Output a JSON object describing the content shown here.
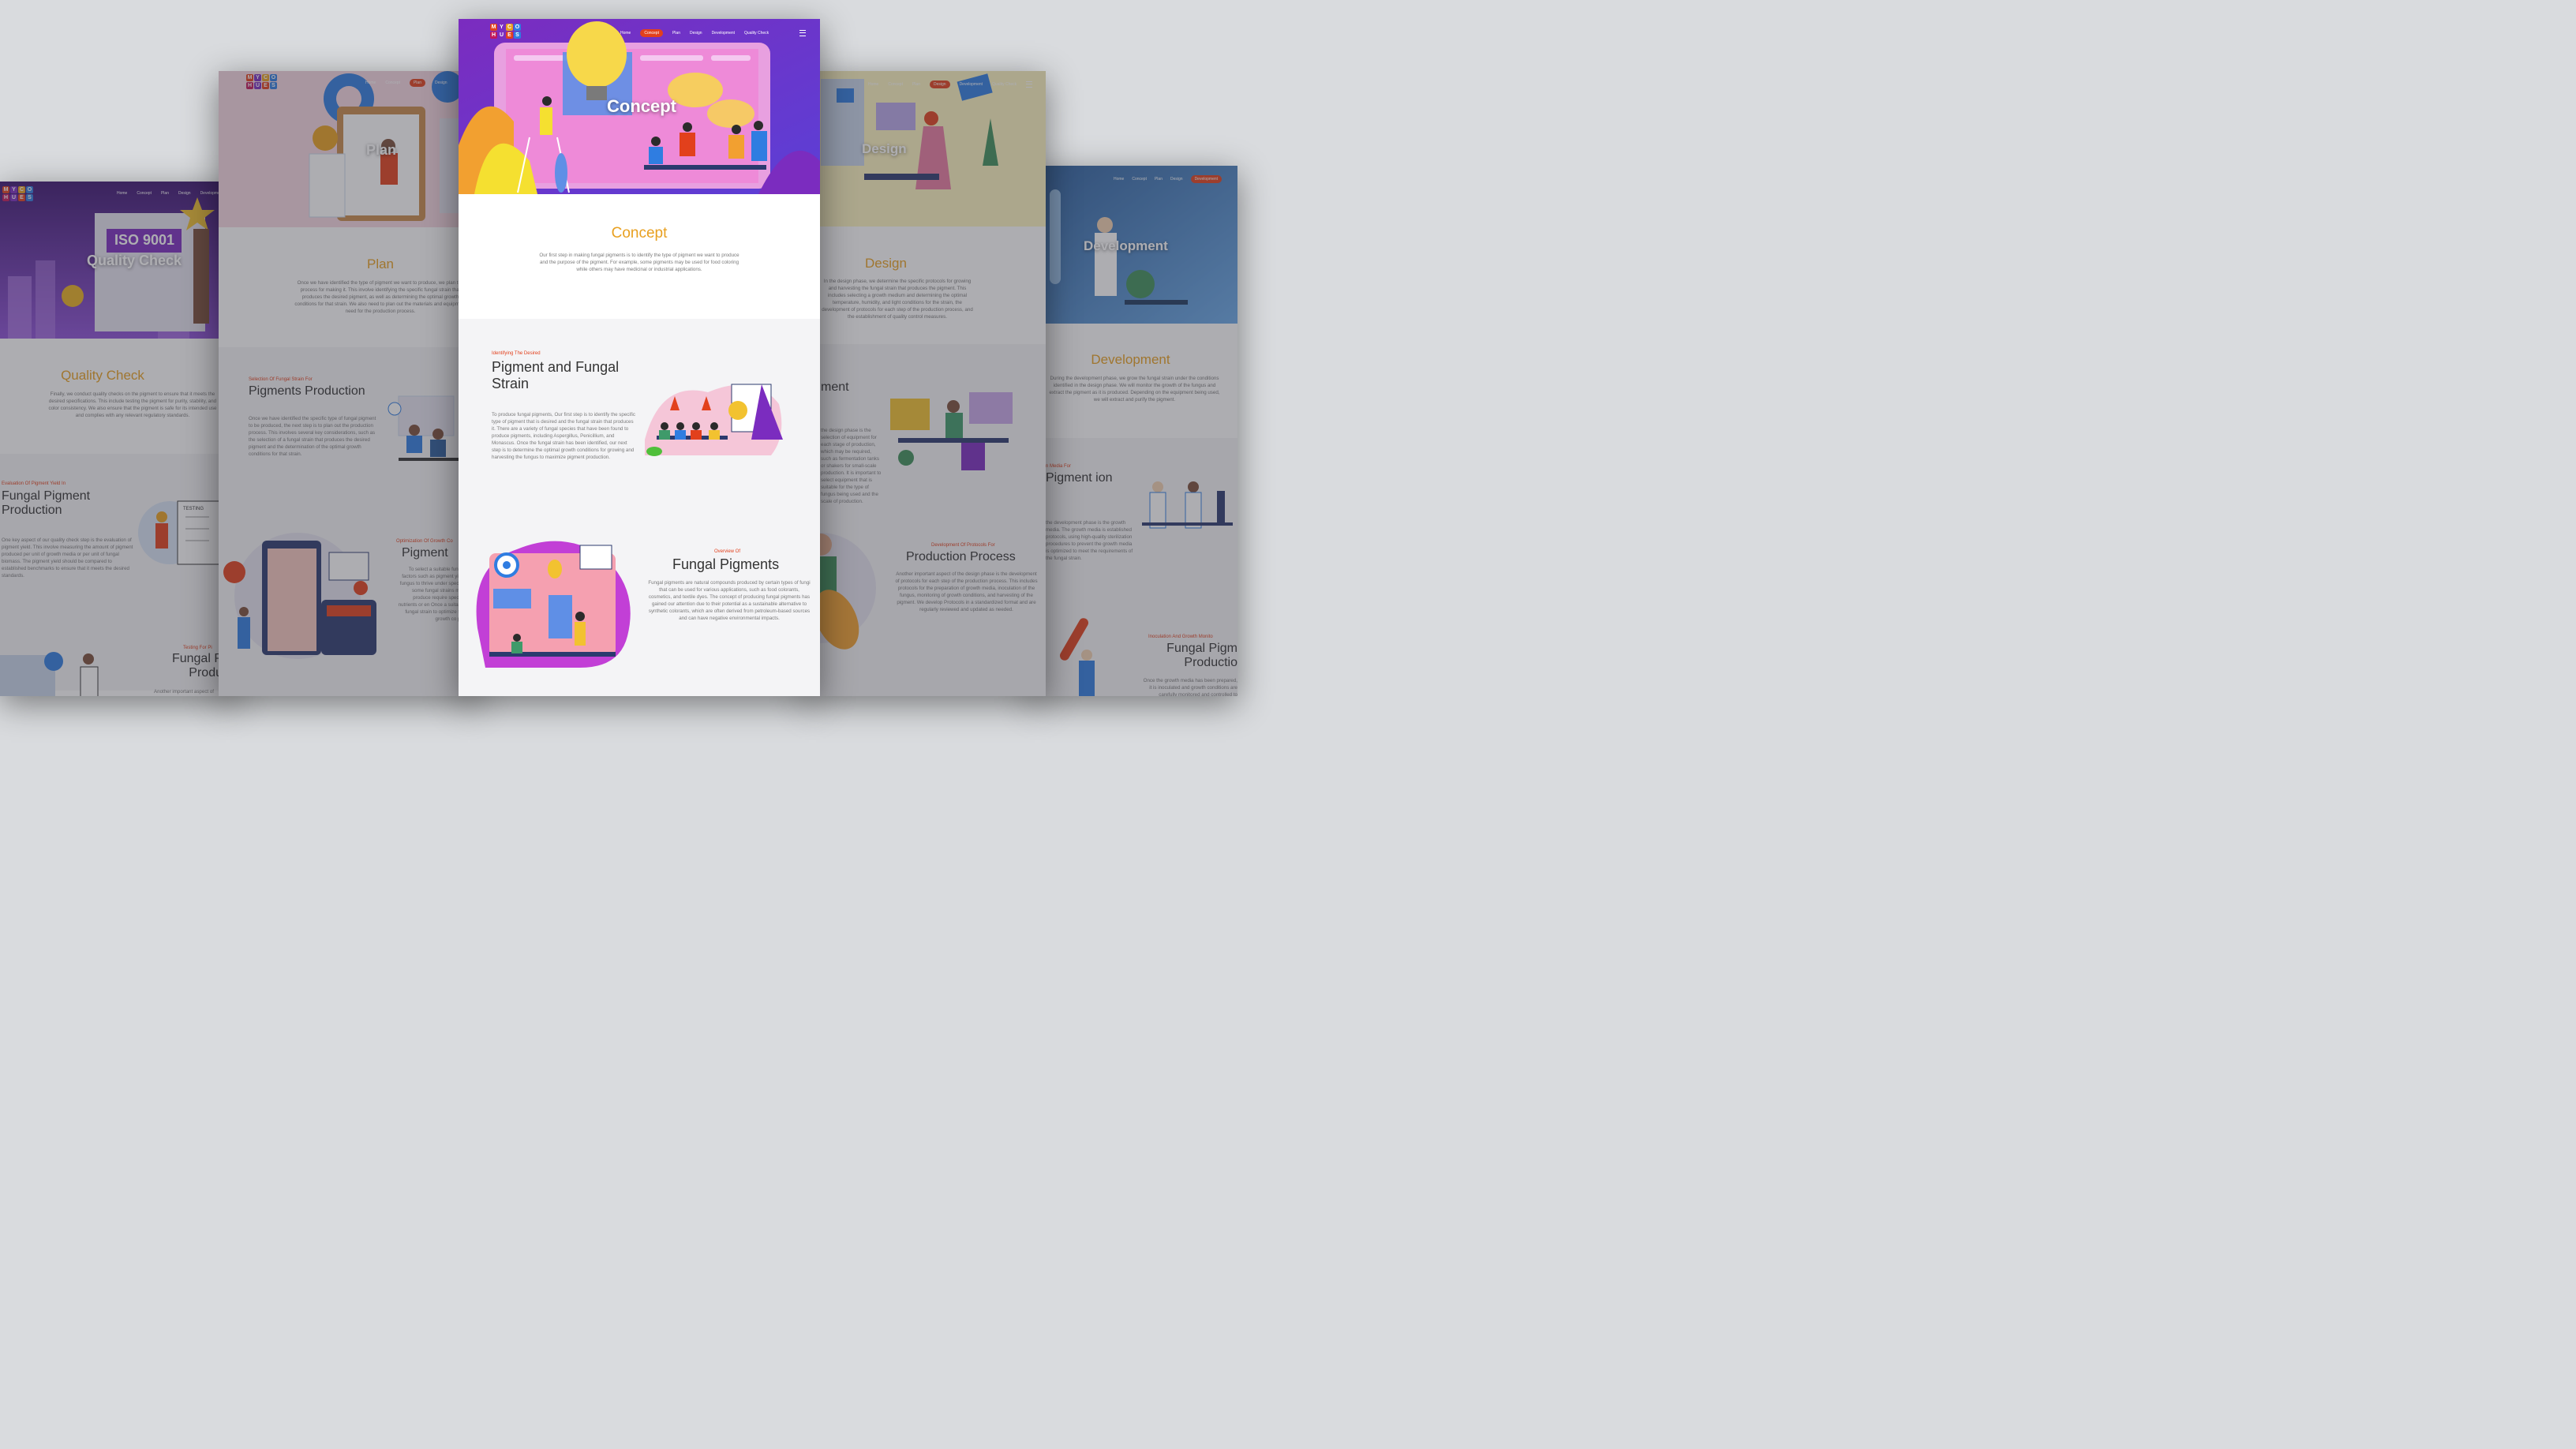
{
  "logo": {
    "letters": [
      "M",
      "Y",
      "C",
      "O",
      "H",
      "U",
      "E",
      "S"
    ],
    "colors": [
      "#e2401c",
      "#7b2cbf",
      "#e8a020",
      "#2f7de1",
      "#c2185b",
      "#7b2cbf",
      "#e2401c",
      "#2f7de1"
    ]
  },
  "nav": {
    "home": "Home",
    "concept": "Concept",
    "plan": "Plan",
    "design": "Design",
    "development": "Development",
    "quality": "Quality Check"
  },
  "quality_page": {
    "hero_badge": "ISO 9001",
    "hero_title": "Quality Check",
    "section_title": "Quality Check",
    "section_text": "Finally, we conduct quality checks on the pigment to ensure that it meets the desired specifications. This include testing the pigment for purity, stability, and color consistency. We also ensure that the pigment is safe for its intended use and complies with any relevant regulatory standards.",
    "f1_eyebrow": "Evaluation Of Pigment Yield In",
    "f1_heading": "Fungal Pigment Production",
    "f1_text": "One key aspect of our quality check step is the evaluation of pigment yield. This involve measuring the amount of pigment produced per unit of growth media or per unit of fungal biomass. The pigment yield should be compared to established benchmarks to ensure that it meets the desired standards.",
    "testing_label": "TESTING",
    "f2_eyebrow": "Testing For Pi",
    "f2_heading": "Fungal P Produ",
    "f2_text": "Another important aspect of"
  },
  "plan_page": {
    "hero_title": "Plan",
    "section_title": "Plan",
    "section_text": "Once we have identified the type of pigment we want to produce, we plan the process for making it. This involve identifying the specific fungal strain that produces the desired pigment, as well as determining the optimal growth conditions for that strain. We also need to plan out the materials and equipment need for the production process.",
    "f1_eyebrow": "Selection Of Fungal Strain For",
    "f1_heading": "Pigments Production",
    "f1_text": "Once we have identified the specific type of fungal pigment to be produced, the next step is to plan out the production process. This involves several key considerations, such as the selection of a fungal strain that produces the desired pigment and the determination of the optimal growth conditions for that strain.",
    "f2_eyebrow": "Optimization Of Growth Co",
    "f2_heading": "Pigment",
    "f2_text": "To select a suitable fungal factors such as pigment yield fungus to thrive under specific some fungal strains may produce require specific nutrients or en Once a suitable fungal strain to optimize the growth co pro"
  },
  "concept_page": {
    "hero_title": "Concept",
    "section_title": "Concept",
    "section_text": "Our first step in making fungal pigments is to identify the type of pigment we want to produce and the purpose of the pigment. For example, some pigments may be used for food coloring while others may have medicinal or industrial applications.",
    "f1_eyebrow": "Identifying The Desired",
    "f1_heading": "Pigment and Fungal Strain",
    "f1_text": "To produce fungal pigments, Our first step is to identify the specific type of pigment that is desired and the fungal strain that produces it. There are a variety of fungal species that have been found to produce pigments, including Aspergillus, Penicillium, and Monascus. Once the fungal strain has been identified, our next step is to determine the optimal growth conditions for growing and harvesting the fungus to maximize pigment production.",
    "f2_eyebrow": "Overview Of",
    "f2_heading": "Fungal Pigments",
    "f2_text": "Fungal pigments are natural compounds produced by certain types of fungi that can be used for various applications, such as food colorants, cosmetics, and textile dyes. The concept of producing fungal pigments has gained our attention due to their potential as a sustainable alternative to synthetic colorants, which are often derived from petroleum-based sources and can have negative environmental impacts."
  },
  "design_page": {
    "hero_title": "Design",
    "section_title": "Design",
    "section_text": "In the design phase, we determine the specific protocols for growing and harvesting the fungal strain that produces the pigment. This includes selecting a growth medium and determining the optimal temperature, humidity, and light conditions for the strain, the development of protocols for each step of the production process, and the establishment of quality control measures.",
    "f1_heading": "ment",
    "f1_text": "the design phase is the selection of equipment for each stage of production, which may be required, such as fermentation tanks or shakers for small-scale production. It is important to select equipment that is suitable for the type of fungus being used and the scale of production.",
    "f2_eyebrow": "Development Of Protocols For",
    "f2_heading": "Production Process",
    "f2_text": "Another important aspect of the design phase is the development of protocols for each step of the production process. This includes protocols for the preparation of growth media, inoculation of the fungus, monitoring of growth conditions, and harvesting of the pigment. We develop Protocols in a standardized format and are regularly reviewed and updated as needed."
  },
  "development_page": {
    "hero_title": "Development",
    "section_title": "Development",
    "section_text": "During the development phase, we grow the fungal strain under the conditions identified in the design phase. We will monitor the growth of the fungus and extract the pigment as it is produced. Depending on the equipment being used, we will extract and purify the pigment.",
    "f1_eyebrow": "n Media For",
    "f1_heading": "Pigment ion",
    "f1_text": "the development phase is the growth media. The growth media is established protocols, using high-quality sterilization procedures to prevent the growth media is optimized to meet the requirements of the fungal strain.",
    "f2_eyebrow": "Inoculation And Growth Monito",
    "f2_heading": "Fungal Pigm Productio",
    "f2_text": "Once the growth media has been prepared, it is inoculated and growth conditions are carefully monitored and controlled to maximize pigment production."
  }
}
